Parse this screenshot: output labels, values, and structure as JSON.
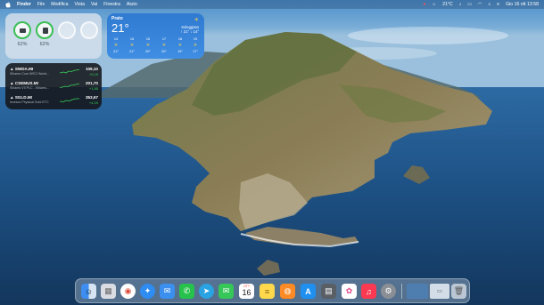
{
  "menubar": {
    "app_name": "Finder",
    "menus": [
      "File",
      "Modifica",
      "Vista",
      "Vai",
      "Finestra",
      "Aiuto"
    ],
    "temperature": "21°C",
    "clock": "Gio 16 ott 13:58"
  },
  "widgets": {
    "battery": {
      "devices": [
        {
          "percent": "62%",
          "level": 0.62
        },
        {
          "percent": "62%",
          "level": 0.62
        }
      ]
    },
    "weather": {
      "city": "Prato",
      "temperature": "21°",
      "condition": "Soleggiato",
      "range": "↑ 21° ↓ 14°",
      "hourly": [
        {
          "hour": "14",
          "temp": "21°"
        },
        {
          "hour": "15",
          "temp": "21°"
        },
        {
          "hour": "16",
          "temp": "20°"
        },
        {
          "hour": "17",
          "temp": "20°"
        },
        {
          "hour": "18",
          "temp": "19°"
        },
        {
          "hour": "19",
          "temp": "17°"
        }
      ]
    },
    "stocks": {
      "items": [
        {
          "symbol": "▲ SWDA.MI",
          "name": "iShares Core MSCI World...",
          "price": "109,10",
          "change": "+0,15"
        },
        {
          "symbol": "▲ CSEMUS.MI",
          "name": "iShares VII PLC - iShares...",
          "price": "201,70",
          "change": "+1,85"
        },
        {
          "symbol": "▲ SGLD.MI",
          "name": "Invesco Physical Gold ETC",
          "price": "353,67",
          "change": "+4,29"
        }
      ]
    }
  },
  "dock": {
    "items": [
      {
        "name": "finder",
        "color": "#3d8ef0",
        "glyph": "☺"
      },
      {
        "name": "launchpad",
        "color": "#d9dde3",
        "glyph": "▦"
      },
      {
        "name": "chrome",
        "color": "#ffffff",
        "glyph": "◉"
      },
      {
        "name": "safari",
        "color": "#2e8cf2",
        "glyph": "✦"
      },
      {
        "name": "mail",
        "color": "#3b8fef",
        "glyph": "✉"
      },
      {
        "name": "whatsapp",
        "color": "#27c24c",
        "glyph": "✆"
      },
      {
        "name": "telegram",
        "color": "#2aa3e3",
        "glyph": "➤"
      },
      {
        "name": "messages",
        "color": "#36c759",
        "glyph": "✉"
      },
      {
        "name": "calendar",
        "color": "#ffffff",
        "glyph": "",
        "month": "OTT",
        "day": "16"
      },
      {
        "name": "notes",
        "color": "#ffd84c",
        "glyph": "≡"
      },
      {
        "name": "photo-app",
        "color": "#ff8a26",
        "glyph": "◍"
      },
      {
        "name": "app-store",
        "color": "#1f8ff0",
        "glyph": "A"
      },
      {
        "name": "calculator",
        "color": "#5a5f66",
        "glyph": "▤"
      },
      {
        "name": "photos",
        "color": "#ffffff",
        "glyph": "✿"
      },
      {
        "name": "music",
        "color": "#fb3a52",
        "glyph": "♫"
      },
      {
        "name": "system-settings",
        "color": "#8a8f96",
        "glyph": "⚙"
      }
    ],
    "trash": {
      "name": "trash",
      "glyph": "🗑"
    }
  }
}
